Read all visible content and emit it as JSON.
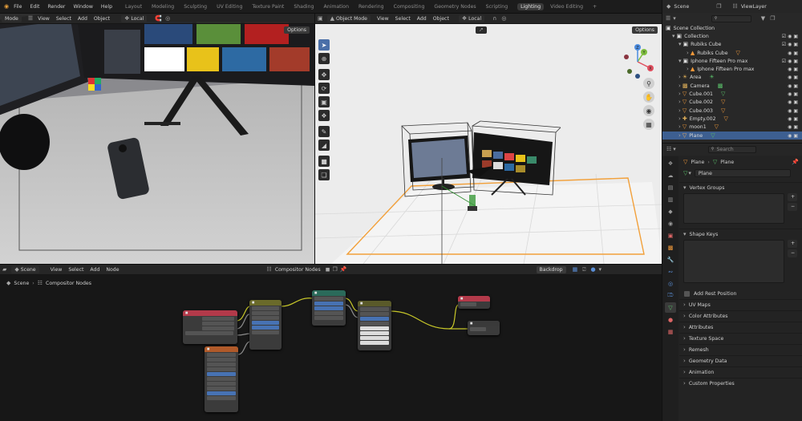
{
  "topbar": {
    "menu": [
      "File",
      "Edit",
      "Render",
      "Window",
      "Help"
    ],
    "workspace_tabs": [
      "Layout",
      "Modeling",
      "Sculpting",
      "UV Editing",
      "Texture Paint",
      "Shading",
      "Animation",
      "Rendering",
      "Compositing",
      "Geometry Nodes",
      "Scripting",
      "Lighting",
      "Video Editing"
    ],
    "active_tab": "Lighting",
    "add_tab": "+",
    "scene_label": "Scene",
    "viewlayer_label": "ViewLayer"
  },
  "camera_view": {
    "mode_label": "Mode",
    "menu": [
      "View",
      "Select",
      "Add",
      "Object"
    ],
    "pivot_label": "Local",
    "options_label": "Options"
  },
  "viewport": {
    "mode_label": "Object Mode",
    "menu": [
      "View",
      "Select",
      "Add",
      "Object"
    ],
    "transform_label": "Local",
    "options_label": "Options",
    "gizmo_axes": {
      "x": "X",
      "y": "Y",
      "z": "Z"
    }
  },
  "node_editor": {
    "scene_label": "Scene",
    "menu": [
      "View",
      "Select",
      "Add",
      "Node"
    ],
    "tree_label": "Compositor Nodes",
    "backdrop_label": "Backdrop",
    "breadcrumb": [
      "Scene",
      "Compositor Nodes"
    ]
  },
  "outliner": {
    "search_placeholder": "",
    "items": [
      {
        "label": "Scene Collection",
        "indent": 0,
        "icon": "collection-icon",
        "selected": false
      },
      {
        "label": "Collection",
        "indent": 1,
        "icon": "collection-icon",
        "selected": false
      },
      {
        "label": "Rubiks Cube",
        "indent": 2,
        "icon": "collection-icon",
        "selected": false
      },
      {
        "label": "Rubiks Cube",
        "indent": 3,
        "icon": "object-icon",
        "selected": false
      },
      {
        "label": "Iphone Fifteen Pro max",
        "indent": 2,
        "icon": "collection-icon",
        "selected": false
      },
      {
        "label": "Iphone Fifteen Pro max",
        "indent": 3,
        "icon": "object-icon",
        "selected": false
      },
      {
        "label": "Area",
        "indent": 2,
        "icon": "light-icon",
        "selected": false
      },
      {
        "label": "Camera",
        "indent": 2,
        "icon": "camera-icon",
        "selected": false
      },
      {
        "label": "Cube.001",
        "indent": 2,
        "icon": "mesh-icon",
        "selected": false
      },
      {
        "label": "Cube.002",
        "indent": 2,
        "icon": "mesh-icon",
        "selected": false
      },
      {
        "label": "Cube.003",
        "indent": 2,
        "icon": "mesh-icon",
        "selected": false
      },
      {
        "label": "Empty.002",
        "indent": 2,
        "icon": "empty-icon",
        "selected": false
      },
      {
        "label": "moon1",
        "indent": 2,
        "icon": "mesh-icon",
        "selected": false
      },
      {
        "label": "Plane",
        "indent": 2,
        "icon": "mesh-icon",
        "selected": true
      }
    ]
  },
  "properties": {
    "search_placeholder": "Search",
    "breadcrumb": [
      "Plane",
      "Plane"
    ],
    "data_name": "Plane",
    "sections": {
      "vertex_groups": "Vertex Groups",
      "shape_keys": "Shape Keys",
      "add_rest_position": "Add Rest Position",
      "collapsed": [
        "UV Maps",
        "Color Attributes",
        "Attributes",
        "Texture Space",
        "Remesh",
        "Geometry Data",
        "Animation",
        "Custom Properties"
      ]
    }
  },
  "colors": {
    "accent": "#4772b3",
    "selection": "#3d5f91",
    "header_bg": "#262626",
    "viewport_bg": "#ececec",
    "active_tab": "#3a3a3a"
  }
}
